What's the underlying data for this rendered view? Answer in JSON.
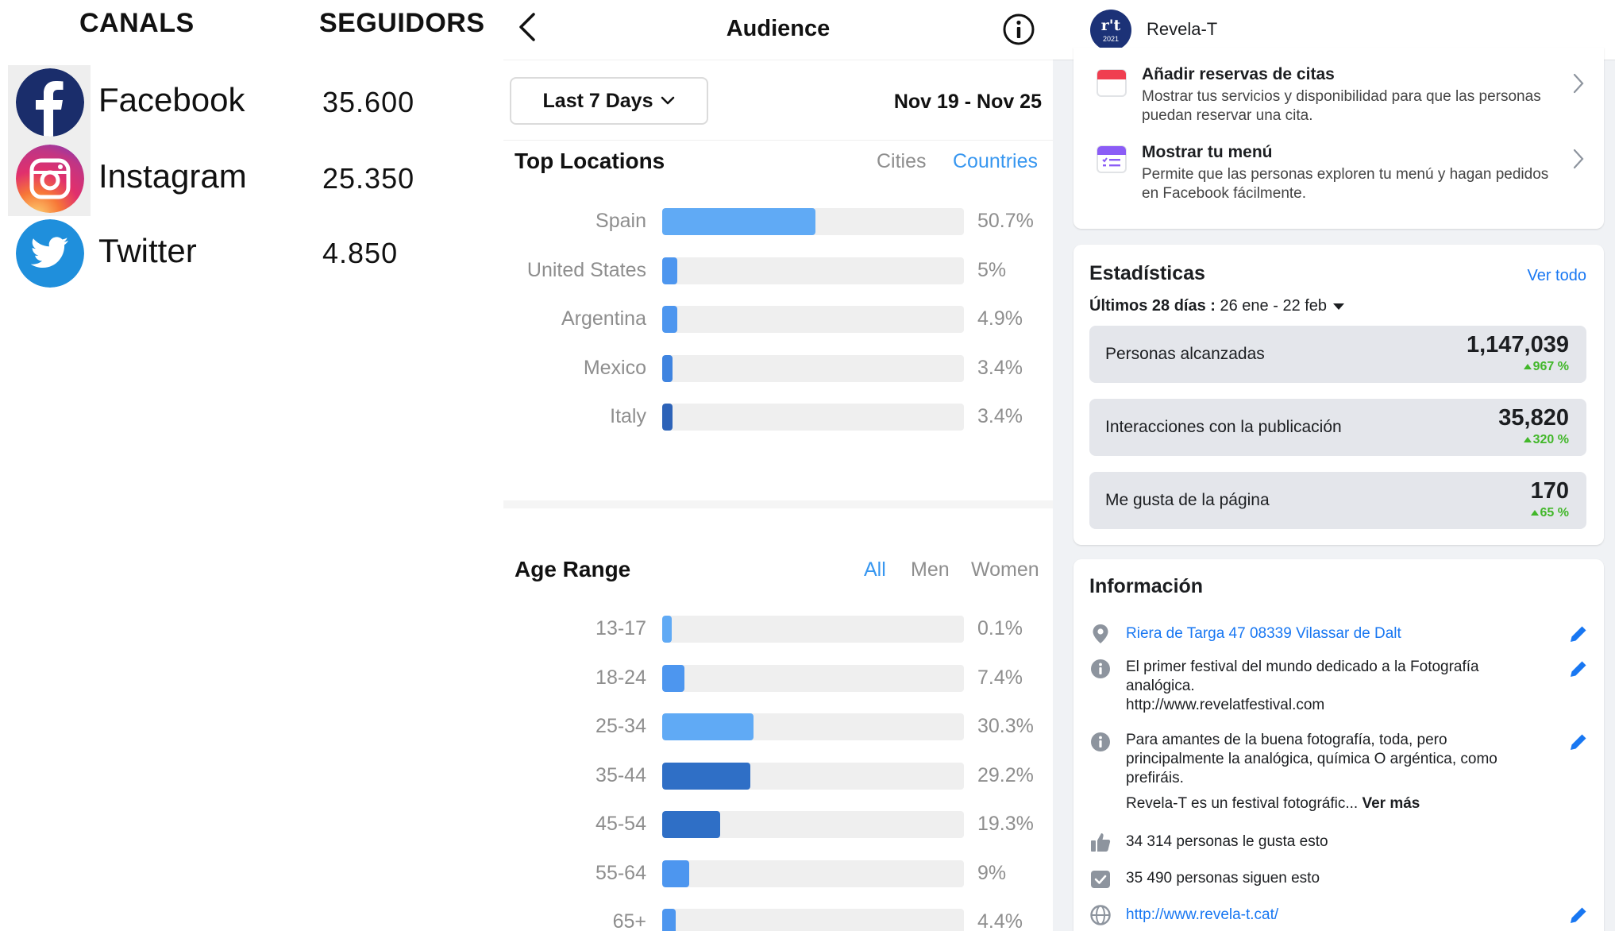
{
  "left": {
    "header_channels": "CANALS",
    "header_followers": "SEGUIDORS",
    "channels": [
      {
        "name": "Facebook",
        "followers": "35.600",
        "icon": "facebook-icon"
      },
      {
        "name": "Instagram",
        "followers": "25.350",
        "icon": "instagram-icon"
      },
      {
        "name": "Twitter",
        "followers": "4.850",
        "icon": "twitter-icon"
      }
    ]
  },
  "audience": {
    "title": "Audience",
    "date_filter": "Last 7 Days",
    "date_range": "Nov 19 - Nov 25",
    "top_locations": {
      "title": "Top Locations",
      "tabs": [
        "Cities",
        "Countries"
      ],
      "active_tab": "Countries",
      "rows": [
        {
          "label": "Spain",
          "value": "50.7%",
          "pct": 50.7,
          "color": "#60aaf5"
        },
        {
          "label": "United States",
          "value": "5%",
          "pct": 5,
          "color": "#4d96ef"
        },
        {
          "label": "Argentina",
          "value": "4.9%",
          "pct": 4.9,
          "color": "#4d96ef"
        },
        {
          "label": "Mexico",
          "value": "3.4%",
          "pct": 3.4,
          "color": "#3f84e0"
        },
        {
          "label": "Italy",
          "value": "3.4%",
          "pct": 3.4,
          "color": "#2d63b8"
        }
      ]
    },
    "age_range": {
      "title": "Age Range",
      "tabs": [
        "All",
        "Men",
        "Women"
      ],
      "active_tab": "All",
      "rows": [
        {
          "label": "13-17",
          "value": "0.1%",
          "pct": 0.1,
          "color": "#60aaf5"
        },
        {
          "label": "18-24",
          "value": "7.4%",
          "pct": 7.4,
          "color": "#4d96ef"
        },
        {
          "label": "25-34",
          "value": "30.3%",
          "pct": 30.3,
          "color": "#60aaf5"
        },
        {
          "label": "35-44",
          "value": "29.2%",
          "pct": 29.2,
          "color": "#2f6fc6"
        },
        {
          "label": "45-54",
          "value": "19.3%",
          "pct": 19.3,
          "color": "#2f6fc6"
        },
        {
          "label": "55-64",
          "value": "9%",
          "pct": 9,
          "color": "#4d96ef"
        },
        {
          "label": "65+",
          "value": "4.4%",
          "pct": 4.4,
          "color": "#4d96ef"
        }
      ]
    }
  },
  "facebook": {
    "page_name": "Revela-T",
    "avatar_text": "r't",
    "avatar_sub": "2021",
    "services": [
      {
        "title": "Añadir reservas de citas",
        "desc": "Mostrar tus servicios y disponibilidad para que las personas puedan reservar una cita.",
        "icon": "calendar-icon"
      },
      {
        "title": "Mostrar tu menú",
        "desc": "Permite que las personas exploren tu menú y hagan pedidos en Facebook fácilmente.",
        "icon": "menu-icon"
      }
    ],
    "stats": {
      "title": "Estadísticas",
      "see_all": "Ver todo",
      "period_label": "Últimos 28 días :",
      "period_range": "26 ene - 22 feb",
      "metrics": [
        {
          "label": "Personas alcanzadas",
          "value": "1,147,039",
          "change": "967 %"
        },
        {
          "label": "Interacciones con la publicación",
          "value": "35,820",
          "change": "320 %"
        },
        {
          "label": "Me gusta de la página",
          "value": "170",
          "change": "65 %"
        }
      ]
    },
    "info": {
      "title": "Información",
      "address": "Riera de Targa 47 08339 Vilassar de Dalt",
      "about_1": "El primer festival del mundo dedicado a la Fotografía analógica.",
      "about_1_url": "http://www.revelatfestival.com",
      "about_2": "Para amantes de la buena fotografía, toda, pero principalmente la analógica, química O argéntica, como prefiráis.",
      "about_2_more_text": "Revela-T es un festival fotográfic...",
      "see_more": "Ver más",
      "likes": "34 314 personas le gusta esto",
      "follows": "35 490 personas siguen esto",
      "website": "http://www.revela-t.cat/"
    }
  }
}
